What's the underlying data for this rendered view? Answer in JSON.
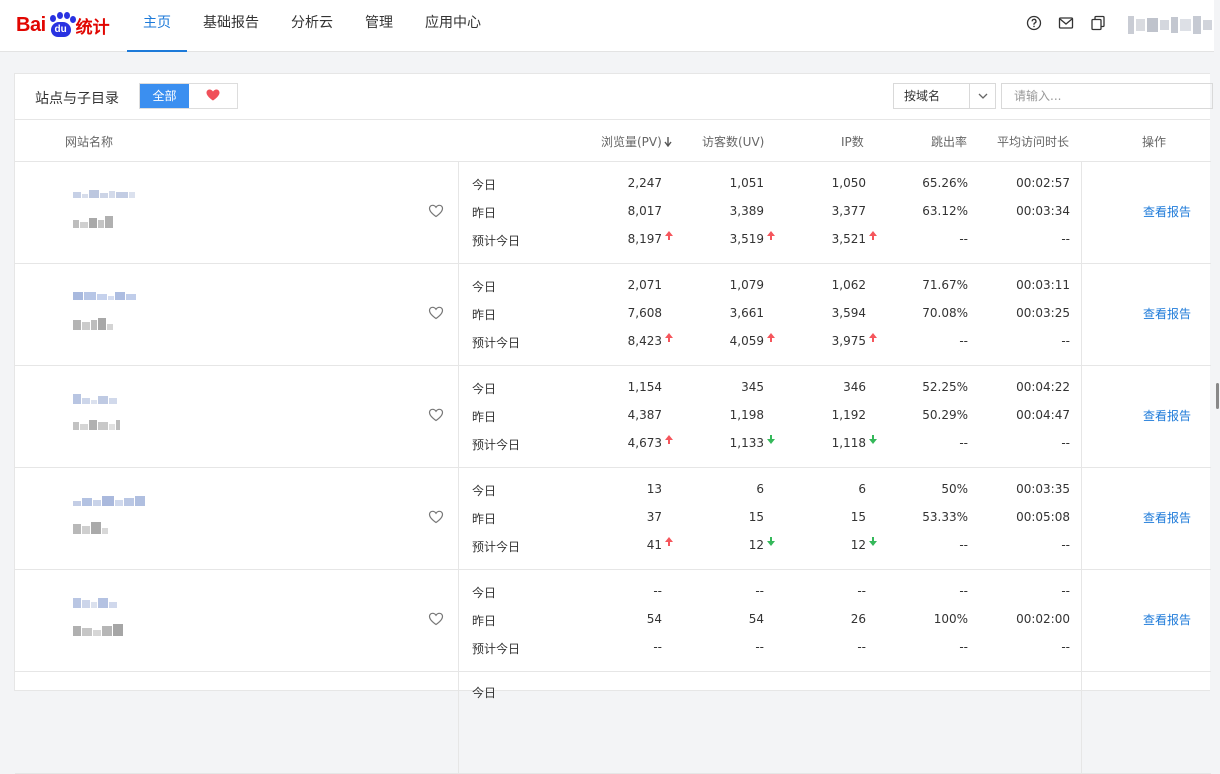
{
  "logo": {
    "bai": "Bai",
    "du": "du",
    "tongji": "统计"
  },
  "nav": [
    {
      "label": "主页",
      "active": true
    },
    {
      "label": "基础报告",
      "active": false
    },
    {
      "label": "分析云",
      "active": false
    },
    {
      "label": "管理",
      "active": false
    },
    {
      "label": "应用中心",
      "active": false
    }
  ],
  "top_icons": [
    "help-icon",
    "mail-icon",
    "copy-icon"
  ],
  "panel": {
    "title": "站点与子目录",
    "filter_all": "全部",
    "filter_fav_icon": "heart-icon",
    "domain_select": "按域名",
    "search_placeholder": "请输入..."
  },
  "columns": {
    "site": "网站名称",
    "pv": "浏览量(PV)",
    "uv": "访客数(UV)",
    "ip": "IP数",
    "bounce": "跳出率",
    "avg_time": "平均访问时长",
    "op": "操作"
  },
  "row_labels": [
    "今日",
    "昨日",
    "预计今日"
  ],
  "op_label": "查看报告",
  "colors": {
    "accent": "#1d7ad9",
    "up": "#f5565c",
    "down": "#35b85a",
    "brand_red": "#e10601",
    "brand_blue": "#2932e1"
  },
  "rows": [
    {
      "today": [
        "2,247",
        "1,051",
        "1,050",
        "65.26%",
        "00:02:57"
      ],
      "yesterday": [
        "8,017",
        "3,389",
        "3,377",
        "63.12%",
        "00:03:34"
      ],
      "forecast": [
        "8,197",
        "3,519",
        "3,521",
        "--",
        "--"
      ],
      "trend": [
        "up",
        "up",
        "up"
      ]
    },
    {
      "today": [
        "2,071",
        "1,079",
        "1,062",
        "71.67%",
        "00:03:11"
      ],
      "yesterday": [
        "7,608",
        "3,661",
        "3,594",
        "70.08%",
        "00:03:25"
      ],
      "forecast": [
        "8,423",
        "4,059",
        "3,975",
        "--",
        "--"
      ],
      "trend": [
        "up",
        "up",
        "up"
      ]
    },
    {
      "today": [
        "1,154",
        "345",
        "346",
        "52.25%",
        "00:04:22"
      ],
      "yesterday": [
        "4,387",
        "1,198",
        "1,192",
        "50.29%",
        "00:04:47"
      ],
      "forecast": [
        "4,673",
        "1,133",
        "1,118",
        "--",
        "--"
      ],
      "trend": [
        "up",
        "down",
        "down"
      ]
    },
    {
      "today": [
        "13",
        "6",
        "6",
        "50%",
        "00:03:35"
      ],
      "yesterday": [
        "37",
        "15",
        "15",
        "53.33%",
        "00:05:08"
      ],
      "forecast": [
        "41",
        "12",
        "12",
        "--",
        "--"
      ],
      "trend": [
        "up",
        "down",
        "down"
      ]
    },
    {
      "today": [
        "--",
        "--",
        "--",
        "--",
        "--"
      ],
      "yesterday": [
        "54",
        "54",
        "26",
        "100%",
        "00:02:00"
      ],
      "forecast": [
        "--",
        "--",
        "--",
        "--",
        "--"
      ],
      "trend": [
        "",
        "",
        ""
      ]
    }
  ],
  "partial_row": {
    "today_label": "今日"
  }
}
